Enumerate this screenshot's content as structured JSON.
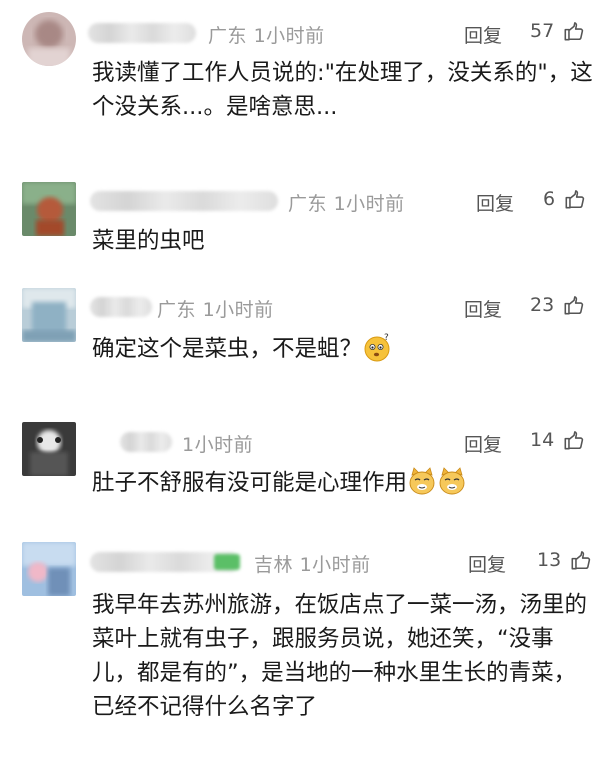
{
  "comments": [
    {
      "location": "广东",
      "time": "1小时前",
      "reply": "回复",
      "likes": "57",
      "text": "我读懂了工作人员说的:\"在处理了，没关系的\"，这个没关系...。是啥意思..."
    },
    {
      "location": "广东",
      "time": "1小时前",
      "reply": "回复",
      "likes": "6",
      "text": "菜里的虫吧"
    },
    {
      "location": "广东",
      "time": "1小时前",
      "reply": "回复",
      "likes": "23",
      "text": "确定这个是菜虫，不是蛆？",
      "emoji": "confused-face-emoji"
    },
    {
      "location": "",
      "time": "1小时前",
      "reply": "回复",
      "likes": "14",
      "text": "肚子不舒服有没可能是心理作用",
      "emoji": "cat-face-emoji"
    },
    {
      "location": "吉林",
      "time": "1小时前",
      "reply": "回复",
      "likes": "13",
      "text": "我早年去苏州旅游，在饭店点了一菜一汤，汤里的菜叶上就有虫子，跟服务员说，她还笑，“没事儿，都是有的”，是当地的一种水里生长的青菜，已经不记得什么名字了"
    }
  ],
  "colors": {
    "meta_text": "#9a9a9a",
    "body_text": "#1a1a1a",
    "action_text": "#555555"
  }
}
